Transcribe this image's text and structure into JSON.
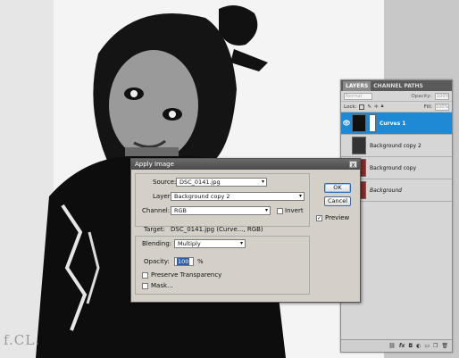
{
  "watermark": "f.CL.",
  "layers_panel": {
    "tabs": [
      "LAYERS",
      "CHANNEL PATHS"
    ],
    "blend_mode_placeholder": "Normal",
    "opacity_label": "Opacity:",
    "opacity_value": "100%",
    "lock_label": "Lock:",
    "fill_label": "Fill:",
    "fill_value": "100%",
    "layers": [
      {
        "name": "Curves 1",
        "selected": true
      },
      {
        "name": "Background copy 2",
        "selected": false
      },
      {
        "name": "Background copy",
        "selected": false
      },
      {
        "name": "Background",
        "selected": false
      }
    ],
    "bottom_icons": [
      "link-icon",
      "fx-icon",
      "mask-icon",
      "adjustment-icon",
      "folder-icon",
      "new-layer-icon",
      "trash-icon"
    ]
  },
  "dialog": {
    "title": "Apply Image",
    "close_glyph": "x",
    "source_label": "Source:",
    "source_value": "DSC_0141.jpg",
    "layer_label": "Layer:",
    "layer_value": "Background copy 2",
    "channel_label": "Channel:",
    "channel_value": "RGB",
    "invert_label": "Invert",
    "invert_checked": false,
    "target_label": "Target:",
    "target_value": "DSC_0141.jpg (Curve..., RGB)",
    "blending_label": "Blending:",
    "blending_value": "Multiply",
    "opacity_label": "Opacity:",
    "opacity_value": "100",
    "opacity_unit": "%",
    "preserve_label": "Preserve Transparency",
    "preserve_checked": false,
    "mask_label": "Mask...",
    "mask_checked": false,
    "ok_label": "OK",
    "cancel_label": "Cancel",
    "preview_label": "Preview",
    "preview_checked": true,
    "arrow_glyph": "▾",
    "check_glyph": "✓"
  }
}
